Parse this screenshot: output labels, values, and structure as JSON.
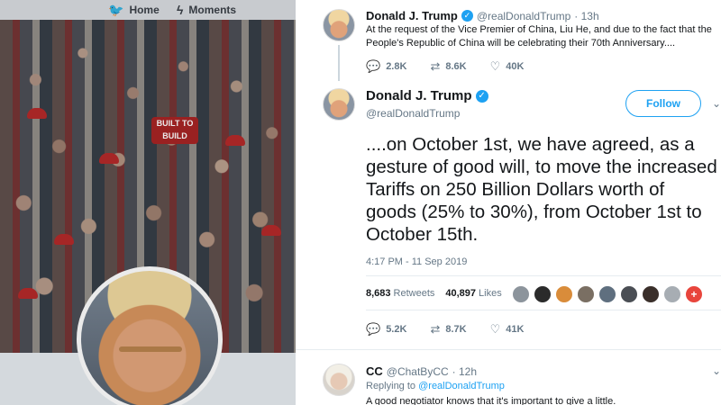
{
  "nav": {
    "home_label": "Home",
    "moments_label": "Moments",
    "home_icon": "twitter-bird-icon",
    "moments_icon": "lightning-icon"
  },
  "background": {
    "hat_text": "BUILT TO BUILD"
  },
  "parent_tweet": {
    "name": "Donald J. Trump",
    "handle": "@realDonaldTrump",
    "time": "· 13h",
    "text_line1": "At the request of the Vice Premier of China, Liu He, and due to the fact that the",
    "text_line2": "People's Republic of China will be celebrating their 70th Anniversary....",
    "replies": "2.8K",
    "retweets": "8.6K",
    "likes": "40K"
  },
  "main_tweet": {
    "name": "Donald J. Trump",
    "handle": "@realDonaldTrump",
    "follow_label": "Follow",
    "text": "....on October 1st, we have agreed, as a gesture of good will, to move the increased Tariffs on 250 Billion Dollars worth of goods (25% to 30%), from October 1st to October 15th.",
    "timestamp": "4:17 PM - 11 Sep 2019",
    "retweet_count": "8,683",
    "retweet_label": "Retweets",
    "like_count": "40,897",
    "like_label": "Likes",
    "replies": "5.2K",
    "retweets": "8.7K",
    "likes": "41K"
  },
  "reply_tweet": {
    "name": "CC",
    "handle": "@ChatByCC",
    "time": "· 12h",
    "replying_prefix": "Replying to",
    "replying_to": "@realDonaldTrump",
    "text": "A good negotiator knows that it's important to give a little."
  },
  "colors": {
    "accent": "#1da1f2",
    "muted": "#657786",
    "text": "#14171a"
  }
}
